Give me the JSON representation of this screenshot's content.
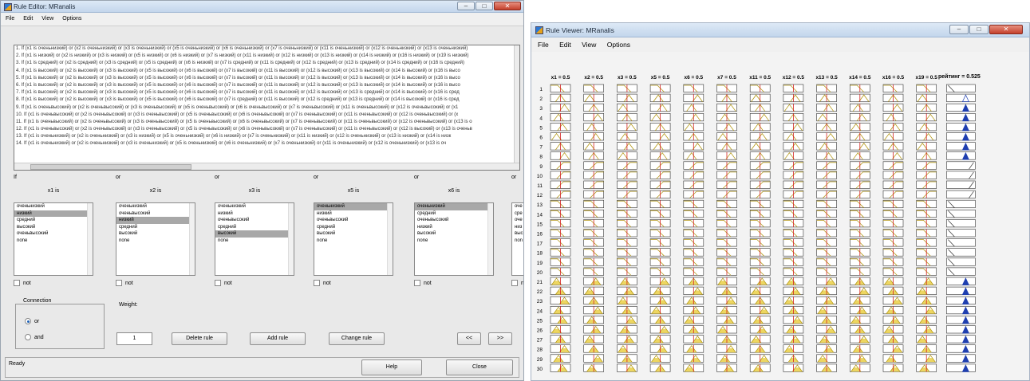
{
  "editor": {
    "title": "Rule Editor: MRanalis",
    "menu": [
      "File",
      "Edit",
      "View",
      "Options"
    ],
    "window_controls": [
      "–",
      "□",
      "✕"
    ],
    "rules": [
      "1. If (x1 is оченьнизкий) or (x2 is оченьнизкий) or (x3 is оченьнизкий) or (x5 is оченьнизкий) or (x6 is оченьнизкий) or (x7 is оченьнизкий) or (x11 is оченьнизкий) or (x12 is оченьнизкий) or (x13 is оченьнизкий)",
      "2. If (x1 is низкий) or (x2 is низкий) or (x3 is низкий) or (x5 is низкий) or (x6 is низкий) or (x7 is низкий) or (x11 is низкий) or (x12 is низкий) or (x13 is низкий) or (x14 is низкий) or (x16 is низкий) or (x19 is низкий)",
      "3. If (x1 is средний) or (x2 is средний) or (x3 is средний) or (x5 is средний) or (x6 is низкий) or (x7 is средний) or (x11 is средний) or (x12 is средний) or (x13 is средний) or (x14 is средний) or (x16 is средний)",
      "4. If (x1 is высокий) or (x2 is высокий) or (x3 is высокий) or (x5 is высокий) or (x6 is высокий) or (x7 is высокий) or (x11 is высокий) or (x12 is высокий) or (x13 is высокий) or (x14 is высокий) or (x16 is высо",
      "5. If (x1 is высокий) or (x2 is высокий) or (x3 is высокий) or (x5 is высокий) or (x6 is высокий) or (x7 is высокий) or (x11 is высокий) or (x12 is высокий) or (x13 is высокий) or (x14 is высокий) or (x16 is высо",
      "6. If (x1 is высокий) or (x2 is высокий) or (x3 is высокий) or (x5 is высокий) or (x6 is высокий) or (x7 is высокий) or (x11 is высокий) or (x12 is высокий) or (x13 is высокий) or (x14 is высокий) or (x16 is высо",
      "7. If (x1 is высокий) or (x2 is высокий) or (x3 is высокий) or (x5 is высокий) or (x6 is высокий) or (x7 is высокий) or (x11 is высокий) or (x12 is высокий) or (x13 is средний) or (x14 is высокий) or (x16 is сред",
      "8. If (x1 is высокий) or (x2 is высокий) or (x3 is высокий) or (x5 is высокий) or (x6 is высокий) or (x7 is средний) or (x11 is высокий) or (x12 is средний) or (x13 is средний) or (x14 is высокий) or (x16 is сред",
      "9. If (x1 is оченьвысокий) or (x2 is оченьвысокий) or (x3 is оченьвысокий) or (x5 is оченьвысокий) or (x6 is оченьвысокий) or (x7 is оченьвысокий) or (x11 is оченьвысокий) or (x12 is оченьвысокий) or (x1",
      "10. If (x1 is оченьвысокий) or (x2 is оченьвысокий) or (x3 is оченьвысокий) or (x5 is оченьвысокий) or (x6 is оченьвысокий) or (x7 is оченьвысокий) or (x11 is оченьвысокий) or (x12 is оченьвысокий) or (x",
      "11. If (x1 is оченьвысокий) or (x2 is оченьвысокий) or (x3 is оченьвысокий) or (x5 is оченьвысокий) or (x6 is оченьвысокий) or (x7 is оченьвысокий) or (x11 is оченьвысокий) or (x12 is оченьвысокий) or (x13 is о",
      "12. If (x1 is оченьвысокий) or (x2 is оченьвысокий) or (x3 is оченьвысокий) or (x5 is оченьвысокий) or (x6 is оченьвысокий) or (x7 is оченьвысокий) or (x11 is оченьвысокий) or (x12 is высокий) or (x13 is оченьв",
      "13. If (x1 is оченьнизкий) or (x2 is оченьнизкий) or (x3 is низкий) or (x5 is оченьнизкий) or (x6 is низкий) or (x7 is оченьнизкий) or (x11 is низкий) or (x12 is оченьнизкий) or (x13 is низкий) or (x14 is низк",
      "14. If (x1 is оченьнизкий) or (x2 is оченьнизкий) or (x3 is оченьнизкий) or (x5 is оченьнизкий) or (x6 is оченьнизкий) or (x7 is оченьнизкий) or (x11 is оченьнизкий) or (x12 is оченьнизкий) or (x13 is оч"
    ],
    "columns": [
      {
        "op": "If",
        "head": "x1 is",
        "options": [
          "оченьнизкий",
          "низкий",
          "средний",
          "высокий",
          "оченьвысокий",
          "none"
        ],
        "selected": 1,
        "not": "not"
      },
      {
        "op": "or",
        "head": "x2 is",
        "options": [
          "оченьнизкий",
          "оченьвысокий",
          "низкий",
          "средний",
          "высокий",
          "none"
        ],
        "selected": 2,
        "not": "not"
      },
      {
        "op": "or",
        "head": "x3 is",
        "options": [
          "оченьнизкий",
          "низкий",
          "оченьвысокий",
          "средний",
          "высокий",
          "none"
        ],
        "selected": 4,
        "not": "not"
      },
      {
        "op": "or",
        "head": "x5 is",
        "options": [
          "оченьнизкий",
          "низкий",
          "оченьвысокий",
          "средний",
          "высокий",
          "none"
        ],
        "selected": 0,
        "not": "not"
      },
      {
        "op": "or",
        "head": "x6 is",
        "options": [
          "оченьнизкий",
          "средний",
          "оченьвысокий",
          "низкий",
          "высокий",
          "none"
        ],
        "selected": 0,
        "not": "not"
      },
      {
        "op": "or",
        "head": "x7 is",
        "options": [
          "оче",
          "сре",
          "оче",
          "низ",
          "выс",
          "non"
        ],
        "selected": -1,
        "not": "n"
      }
    ],
    "connection": {
      "title": "Connection",
      "or": "or",
      "and": "and",
      "selected": "or"
    },
    "weight": {
      "label": "Weight:",
      "value": "1"
    },
    "buttons": {
      "delete": "Delete rule",
      "add": "Add rule",
      "change": "Change rule",
      "prev": "<<",
      "next": ">>",
      "help": "Help",
      "close": "Close"
    },
    "status": "Ready"
  },
  "viewer": {
    "title": "Rule Viewer: MRanalis",
    "menu": [
      "File",
      "Edit",
      "View",
      "Options"
    ],
    "window_controls": [
      "–",
      "□",
      "✕"
    ],
    "inputs": [
      {
        "label": "x1 = 0.5",
        "value": 0.5
      },
      {
        "label": "x2 = 0.5",
        "value": 0.5
      },
      {
        "label": "x3 = 0.5",
        "value": 0.5
      },
      {
        "label": "x5 = 0.5",
        "value": 0.5
      },
      {
        "label": "x6 = 0.5",
        "value": 0.5
      },
      {
        "label": "x7 = 0.5",
        "value": 0.5
      },
      {
        "label": "x11 = 0.5",
        "value": 0.5
      },
      {
        "label": "x12 = 0.5",
        "value": 0.5
      },
      {
        "label": "x13 = 0.5",
        "value": 0.5
      },
      {
        "label": "x14 = 0.5",
        "value": 0.5
      },
      {
        "label": "x16 = 0.5",
        "value": 0.5
      },
      {
        "label": "x19 = 0.5",
        "value": 0.5
      }
    ],
    "output": {
      "label": "рейтинг = 0.525",
      "value": 0.525
    },
    "row_numbers": [
      "1",
      "2",
      "3",
      "4",
      "5",
      "6",
      "7",
      "8",
      "9",
      "10",
      "11",
      "12",
      "13",
      "14",
      "15",
      "16",
      "17",
      "18",
      "19",
      "20",
      "21",
      "22",
      "23",
      "24",
      "25",
      "26",
      "27",
      "28",
      "29",
      "30"
    ],
    "row_shapes": [
      "lshoulder",
      "tri",
      "tri",
      "tri",
      "tri",
      "tri",
      "tri",
      "tri",
      "rshoulder",
      "rshoulder",
      "rshoulder",
      "rshoulder",
      "lshoulder",
      "lshoulder",
      "lshoulder",
      "lshoulder",
      "lshoulder",
      "lshoulder",
      "lshoulder",
      "lshoulder",
      "tri",
      "tri",
      "tri",
      "tri",
      "tri",
      "tri",
      "tri",
      "tri",
      "tri",
      "tri"
    ],
    "colors": {
      "mf_line": "#b59a1c",
      "mf_fill": "#e8cc3a",
      "input_line": "#d42020",
      "output_fill": "#1f3fb0"
    }
  }
}
